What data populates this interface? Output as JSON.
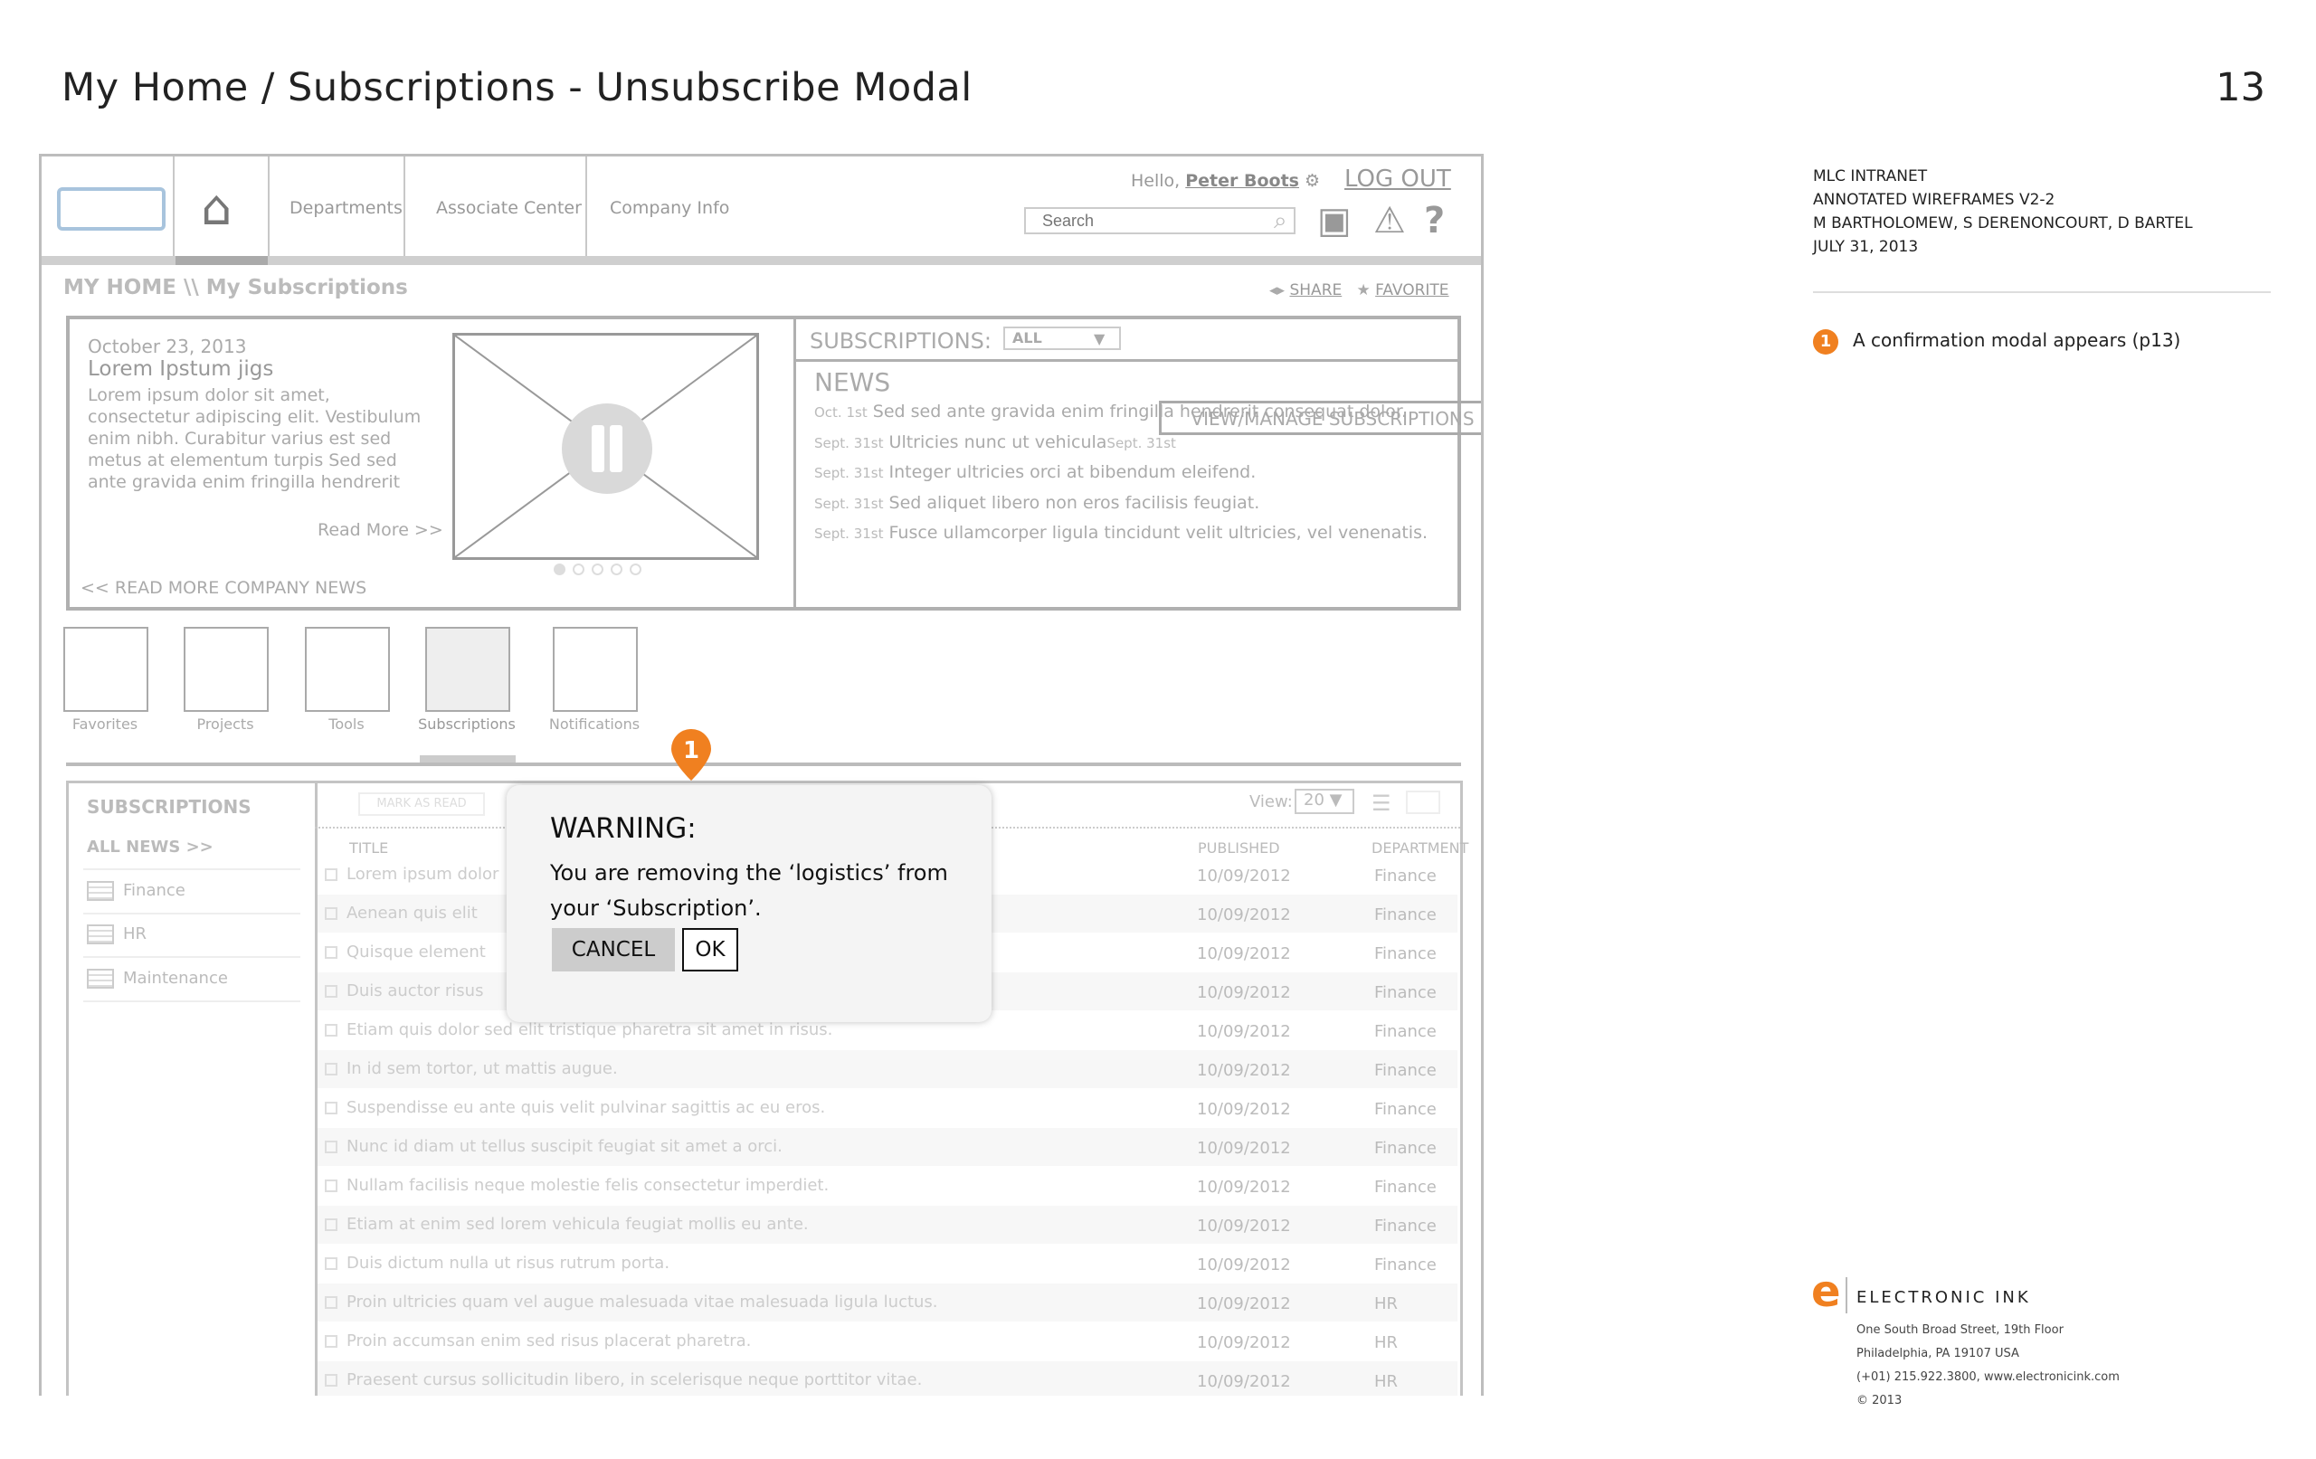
{
  "page": {
    "title": "My Home / Subscriptions - Unsubscribe Modal",
    "number": "13"
  },
  "nav": {
    "items": [
      "Departments",
      "Associate Center",
      "Company Info"
    ],
    "hello": "Hello,",
    "user": "Peter Boots",
    "logout": "LOG OUT",
    "search_placeholder": "Search"
  },
  "breadcrumb": "MY HOME \\\\ My Subscriptions",
  "actions": {
    "share": "SHARE",
    "favorite": "FAVORITE"
  },
  "feature": {
    "date": "October 23, 2013",
    "headline": "Lorem Ipstum jigs",
    "body": "Lorem ipsum dolor sit amet, consectetur adipiscing elit. Vestibulum enim nibh. Curabitur varius est sed metus at elementum turpis Sed sed ante gravida enim fringilla hendrerit",
    "read_more": "Read More >>",
    "read_more_company": "<< READ MORE COMPANY NEWS"
  },
  "subscriptions_panel": {
    "label": "SUBSCRIPTIONS:",
    "filter": "ALL",
    "news_title": "NEWS",
    "news": [
      {
        "date": "Oct. 1st",
        "text": "Sed sed ante gravida enim fringilla hendrerit consequat  dolor.",
        "suffix": ""
      },
      {
        "date": "Sept. 31st",
        "text": "Ultricies nunc ut vehicula",
        "suffix": "Sept. 31st"
      },
      {
        "date": "Sept. 31st",
        "text": "Integer ultricies orci at bibendum eleifend.",
        "suffix": ""
      },
      {
        "date": "Sept. 31st",
        "text": "Sed aliquet libero non eros facilisis feugiat.",
        "suffix": ""
      },
      {
        "date": "Sept. 31st",
        "text": "Fusce ullamcorper ligula tincidunt velit ultricies, vel venenatis.",
        "suffix": ""
      }
    ],
    "manage_button": "VIEW/MANAGE SUBSCRIPTIONS"
  },
  "tiles": [
    "Favorites",
    "Projects",
    "Tools",
    "Subscriptions",
    "Notifications"
  ],
  "list": {
    "sidebar_title": "SUBSCRIPTIONS",
    "all_news": "ALL NEWS >>",
    "categories": [
      "Finance",
      "HR",
      "Maintenance"
    ],
    "mark_read": "MARK AS READ",
    "view_label": "View:",
    "view_value": "20",
    "columns": {
      "title": "TITLE",
      "published": "PUBLISHED",
      "department": "DEPARTMENT"
    },
    "rows": [
      {
        "title": "Lorem ipsum dolor",
        "date": "10/09/2012",
        "dept": "Finance"
      },
      {
        "title": "Aenean quis elit",
        "date": "10/09/2012",
        "dept": "Finance"
      },
      {
        "title": "Quisque element",
        "date": "10/09/2012",
        "dept": "Finance"
      },
      {
        "title": "Duis auctor risus",
        "date": "10/09/2012",
        "dept": "Finance"
      },
      {
        "title": "Etiam quis dolor sed elit tristique pharetra sit amet in risus.",
        "date": "10/09/2012",
        "dept": "Finance"
      },
      {
        "title": "In id sem tortor, ut mattis augue.",
        "date": "10/09/2012",
        "dept": "Finance"
      },
      {
        "title": "Suspendisse eu ante quis velit pulvinar sagittis ac eu eros.",
        "date": "10/09/2012",
        "dept": "Finance"
      },
      {
        "title": "Nunc id diam ut tellus suscipit feugiat sit amet a orci.",
        "date": "10/09/2012",
        "dept": "Finance"
      },
      {
        "title": "Nullam facilisis neque molestie felis consectetur imperdiet.",
        "date": "10/09/2012",
        "dept": "Finance"
      },
      {
        "title": "Etiam at enim sed lorem vehicula feugiat mollis eu ante.",
        "date": "10/09/2012",
        "dept": "Finance"
      },
      {
        "title": "Duis dictum nulla ut risus rutrum porta.",
        "date": "10/09/2012",
        "dept": "Finance"
      },
      {
        "title": "Proin ultricies quam vel augue malesuada vitae malesuada ligula luctus.",
        "date": "10/09/2012",
        "dept": "HR"
      },
      {
        "title": "Proin accumsan enim sed risus placerat pharetra.",
        "date": "10/09/2012",
        "dept": "HR"
      },
      {
        "title": "Praesent cursus sollicitudin libero, in scelerisque neque porttitor vitae.",
        "date": "10/09/2012",
        "dept": "HR"
      }
    ]
  },
  "modal": {
    "title": "WARNING:",
    "message": "You are removing the ‘logistics’ from your  ‘Subscription’.",
    "cancel": "CANCEL",
    "ok": "OK"
  },
  "annotation": {
    "pin": "1",
    "note": "A confirmation modal appears (p13)"
  },
  "meta": {
    "lines": [
      "MLC INTRANET",
      "ANNOTATED WIREFRAMES V2-2",
      "M BARTHOLOMEW, S DERENONCOURT, D BARTEL",
      "JULY 31, 2013"
    ]
  },
  "footer": {
    "logo_letter": "e",
    "company": "ELECTRONIC INK",
    "address": [
      "One South Broad Street, 19th Floor",
      "Philadelphia, PA 19107 USA",
      "(+01) 215.922.3800, www.electronicink.com",
      "© 2013"
    ]
  },
  "colors": {
    "accent": "#f08020",
    "logo_blue": "#a8c4dd"
  }
}
